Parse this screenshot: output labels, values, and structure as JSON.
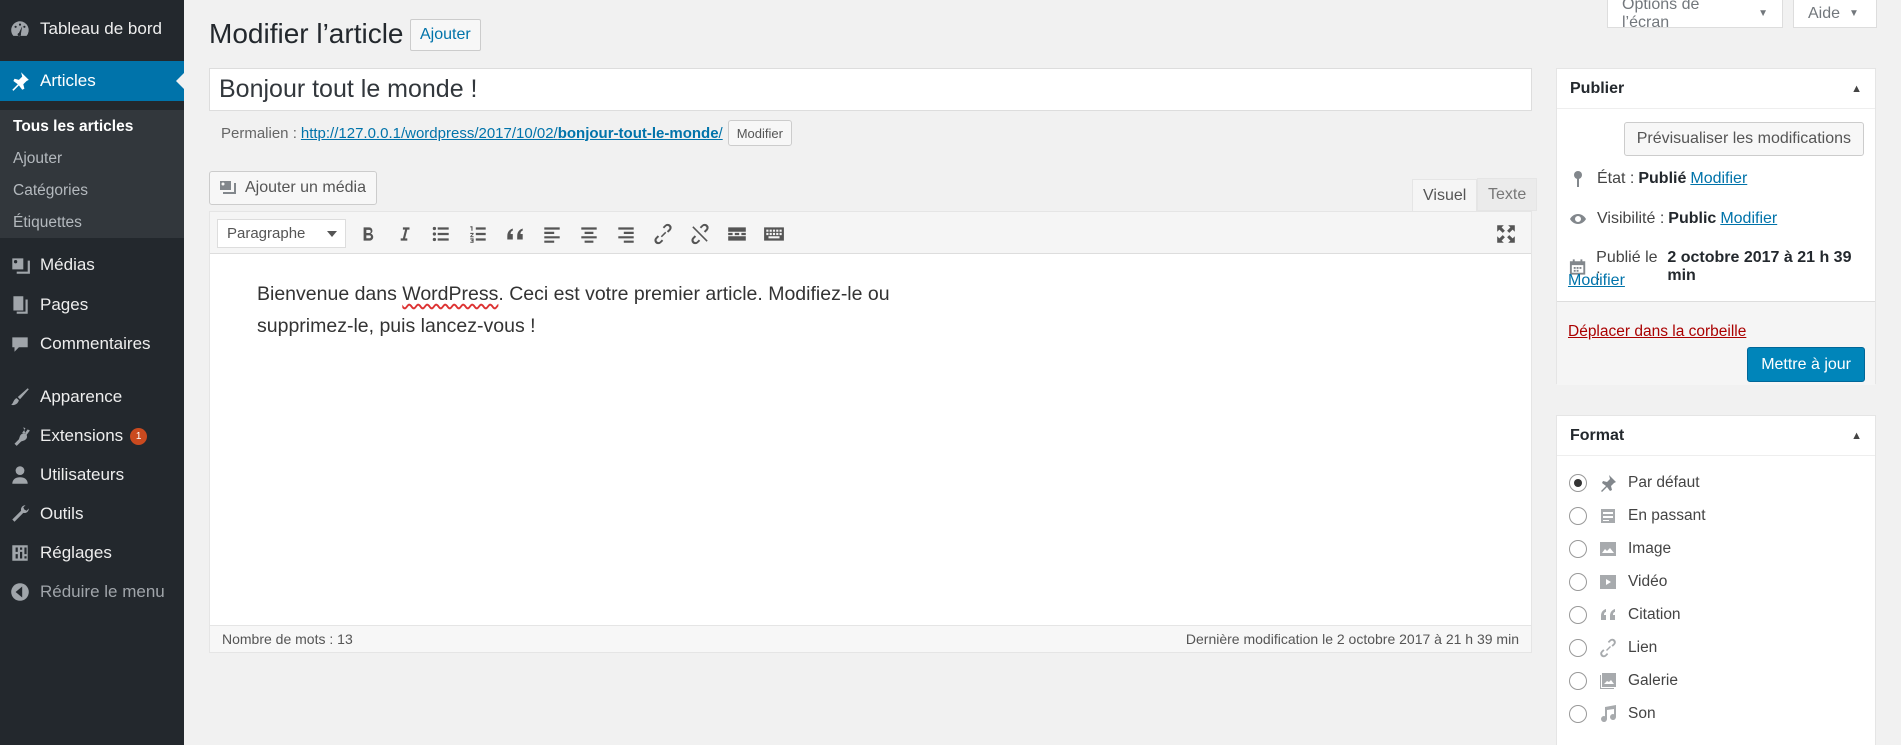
{
  "sidebar": {
    "dashboard": "Tableau de bord",
    "articles": "Articles",
    "submenu": [
      "Tous les articles",
      "Ajouter",
      "Catégories",
      "Étiquettes"
    ],
    "media": "Médias",
    "pages": "Pages",
    "comments": "Commentaires",
    "appearance": "Apparence",
    "plugins": "Extensions",
    "plugins_badge": "1",
    "users": "Utilisateurs",
    "tools": "Outils",
    "settings": "Réglages",
    "collapse": "Réduire le menu"
  },
  "topbar": {
    "screen_options": "Options de l’écran",
    "help": "Aide"
  },
  "heading": {
    "title": "Modifier l’article",
    "add_new": "Ajouter"
  },
  "post": {
    "title": "Bonjour tout le monde !",
    "permalink_label": "Permalien :",
    "permalink_base": "http://127.0.0.1/wordpress/2017/10/02/",
    "permalink_slug": "bonjour-tout-le-monde",
    "permalink_end": "/",
    "permalink_edit": "Modifier"
  },
  "editor": {
    "add_media": "Ajouter un média",
    "tab_visual": "Visuel",
    "tab_text": "Texte",
    "format_select": "Paragraphe",
    "content_part1": "Bienvenue dans ",
    "content_wp": "WordPress",
    "content_part2": ". Ceci est votre premier article. Modifiez-le ou supprimez-le, puis lancez-vous !",
    "word_count": "Nombre de mots : 13",
    "last_edit": "Dernière modification le 2 octobre 2017 à 21 h 39 min"
  },
  "publish": {
    "title": "Publier",
    "preview": "Prévisualiser les modifications",
    "status_label": "État :",
    "status_value": "Publié",
    "visibility_label": "Visibilité :",
    "visibility_value": "Public",
    "published_label": "Publié le :",
    "published_value": "2 octobre 2017 à 21 h 39 min",
    "edit": "Modifier",
    "trash": "Déplacer dans la corbeille",
    "update": "Mettre à jour"
  },
  "format": {
    "title": "Format",
    "options": [
      "Par défaut",
      "En passant",
      "Image",
      "Vidéo",
      "Citation",
      "Lien",
      "Galerie",
      "Son"
    ],
    "selected": "Par défaut"
  },
  "colors": {
    "admin_menu": "#23282d",
    "accent": "#0073aa",
    "primary_button": "#0085ba",
    "trash": "#a00"
  }
}
